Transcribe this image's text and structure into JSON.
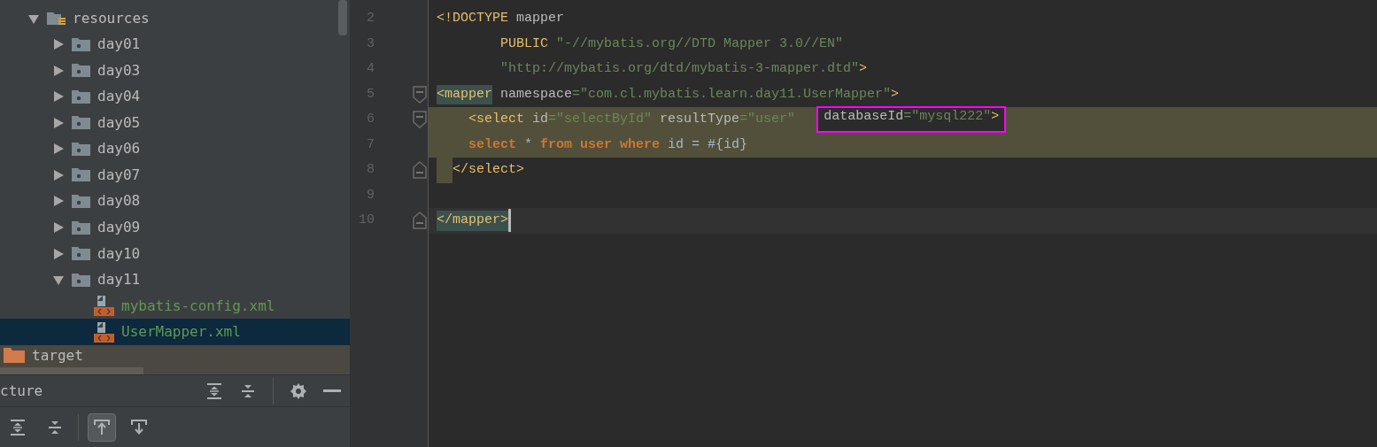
{
  "project_tree": {
    "items": [
      {
        "label": "resources",
        "kind": "resource-root",
        "expanded": true,
        "selected": false,
        "children": [
          {
            "label": "day01",
            "kind": "source-folder",
            "expanded": false,
            "selected": false
          },
          {
            "label": "day03",
            "kind": "source-folder",
            "expanded": false,
            "selected": false
          },
          {
            "label": "day04",
            "kind": "source-folder",
            "expanded": false,
            "selected": false
          },
          {
            "label": "day05",
            "kind": "source-folder",
            "expanded": false,
            "selected": false
          },
          {
            "label": "day06",
            "kind": "source-folder",
            "expanded": false,
            "selected": false
          },
          {
            "label": "day07",
            "kind": "source-folder",
            "expanded": false,
            "selected": false
          },
          {
            "label": "day08",
            "kind": "source-folder",
            "expanded": false,
            "selected": false
          },
          {
            "label": "day09",
            "kind": "source-folder",
            "expanded": false,
            "selected": false
          },
          {
            "label": "day10",
            "kind": "source-folder",
            "expanded": false,
            "selected": false
          },
          {
            "label": "day11",
            "kind": "source-folder",
            "expanded": true,
            "selected": false,
            "children": [
              {
                "label": "mybatis-config.xml",
                "kind": "xml-file",
                "selected": false
              },
              {
                "label": "UserMapper.xml",
                "kind": "xml-file",
                "selected": true
              }
            ]
          }
        ]
      }
    ],
    "outer_items": [
      {
        "label": "target",
        "kind": "excluded-folder",
        "selected": false
      }
    ]
  },
  "structure_panel": {
    "title": "cture",
    "toolbar": [
      {
        "kind": "expand",
        "selected": false
      },
      {
        "kind": "collapse",
        "selected": false
      },
      {
        "kind": "scroll-from-source",
        "selected": true
      },
      {
        "kind": "scroll-to-source",
        "selected": false
      }
    ]
  },
  "editor": {
    "lines": [
      {
        "number": "2",
        "current": false,
        "highlighted": false,
        "fold_start": false,
        "fold_end": false,
        "tokens": [
          {
            "kind": "doctype",
            "text": "<!DOCTYPE "
          },
          {
            "kind": "attr",
            "text": "mapper"
          }
        ]
      },
      {
        "number": "3",
        "current": false,
        "highlighted": false,
        "fold_start": false,
        "fold_end": false,
        "tokens": [
          {
            "kind": "doctype",
            "text": "        PUBLIC "
          },
          {
            "kind": "string",
            "text": "\"-//mybatis.org//DTD Mapper 3.0//EN\""
          }
        ]
      },
      {
        "number": "4",
        "current": false,
        "highlighted": false,
        "fold_start": false,
        "fold_end": false,
        "tokens": [
          {
            "kind": "string",
            "text": "        \"http://mybatis.org/dtd/mybatis-3-mapper.dtd\""
          },
          {
            "kind": "tag",
            "text": ">"
          }
        ]
      },
      {
        "number": "5",
        "current": false,
        "highlighted": false,
        "fold_start": true,
        "fold_end": false,
        "tokens": [
          {
            "kind": "matched-tag",
            "text": "<mapper"
          },
          {
            "kind": "attr",
            "text": " namespace"
          },
          {
            "kind": "string",
            "text": "=\"com.cl.mybatis.learn.day11.UserMapper\""
          },
          {
            "kind": "tag",
            "text": ">"
          }
        ]
      },
      {
        "number": "6",
        "current": false,
        "highlighted": true,
        "highlight_end": false,
        "fold_start": true,
        "fold_end": false,
        "tokens": [
          {
            "kind": "tag",
            "text": "    <select"
          },
          {
            "kind": "attr",
            "text": " id"
          },
          {
            "kind": "string",
            "text": "=\"selectById\""
          },
          {
            "kind": "attr",
            "text": " resultType"
          },
          {
            "kind": "string",
            "text": "=\"user\"  "
          }
        ],
        "annotated_tokens": [
          {
            "kind": "attr",
            "text": "databaseId"
          },
          {
            "kind": "string",
            "text": "=\"mysql222\""
          },
          {
            "kind": "tag",
            "text": ">"
          }
        ]
      },
      {
        "number": "7",
        "current": false,
        "highlighted": true,
        "highlight_end": false,
        "fold_start": false,
        "fold_end": false,
        "tokens": [
          {
            "kind": "keyword",
            "text": "    select"
          },
          {
            "kind": "plain",
            "text": " * "
          },
          {
            "kind": "keyword",
            "text": "from user where"
          },
          {
            "kind": "plain",
            "text": " id = #{id}"
          }
        ]
      },
      {
        "number": "8",
        "current": false,
        "highlighted": true,
        "highlight_end": true,
        "fold_start": false,
        "fold_end": true,
        "tokens": [
          {
            "kind": "tag",
            "text": "</select>"
          }
        ]
      },
      {
        "number": "9",
        "current": false,
        "highlighted": false,
        "fold_start": false,
        "fold_end": false
      },
      {
        "number": "10",
        "current": true,
        "highlighted": false,
        "fold_start": false,
        "fold_end": true,
        "tokens": [
          {
            "kind": "matched-tag",
            "text": "</mapper>"
          }
        ]
      }
    ]
  }
}
